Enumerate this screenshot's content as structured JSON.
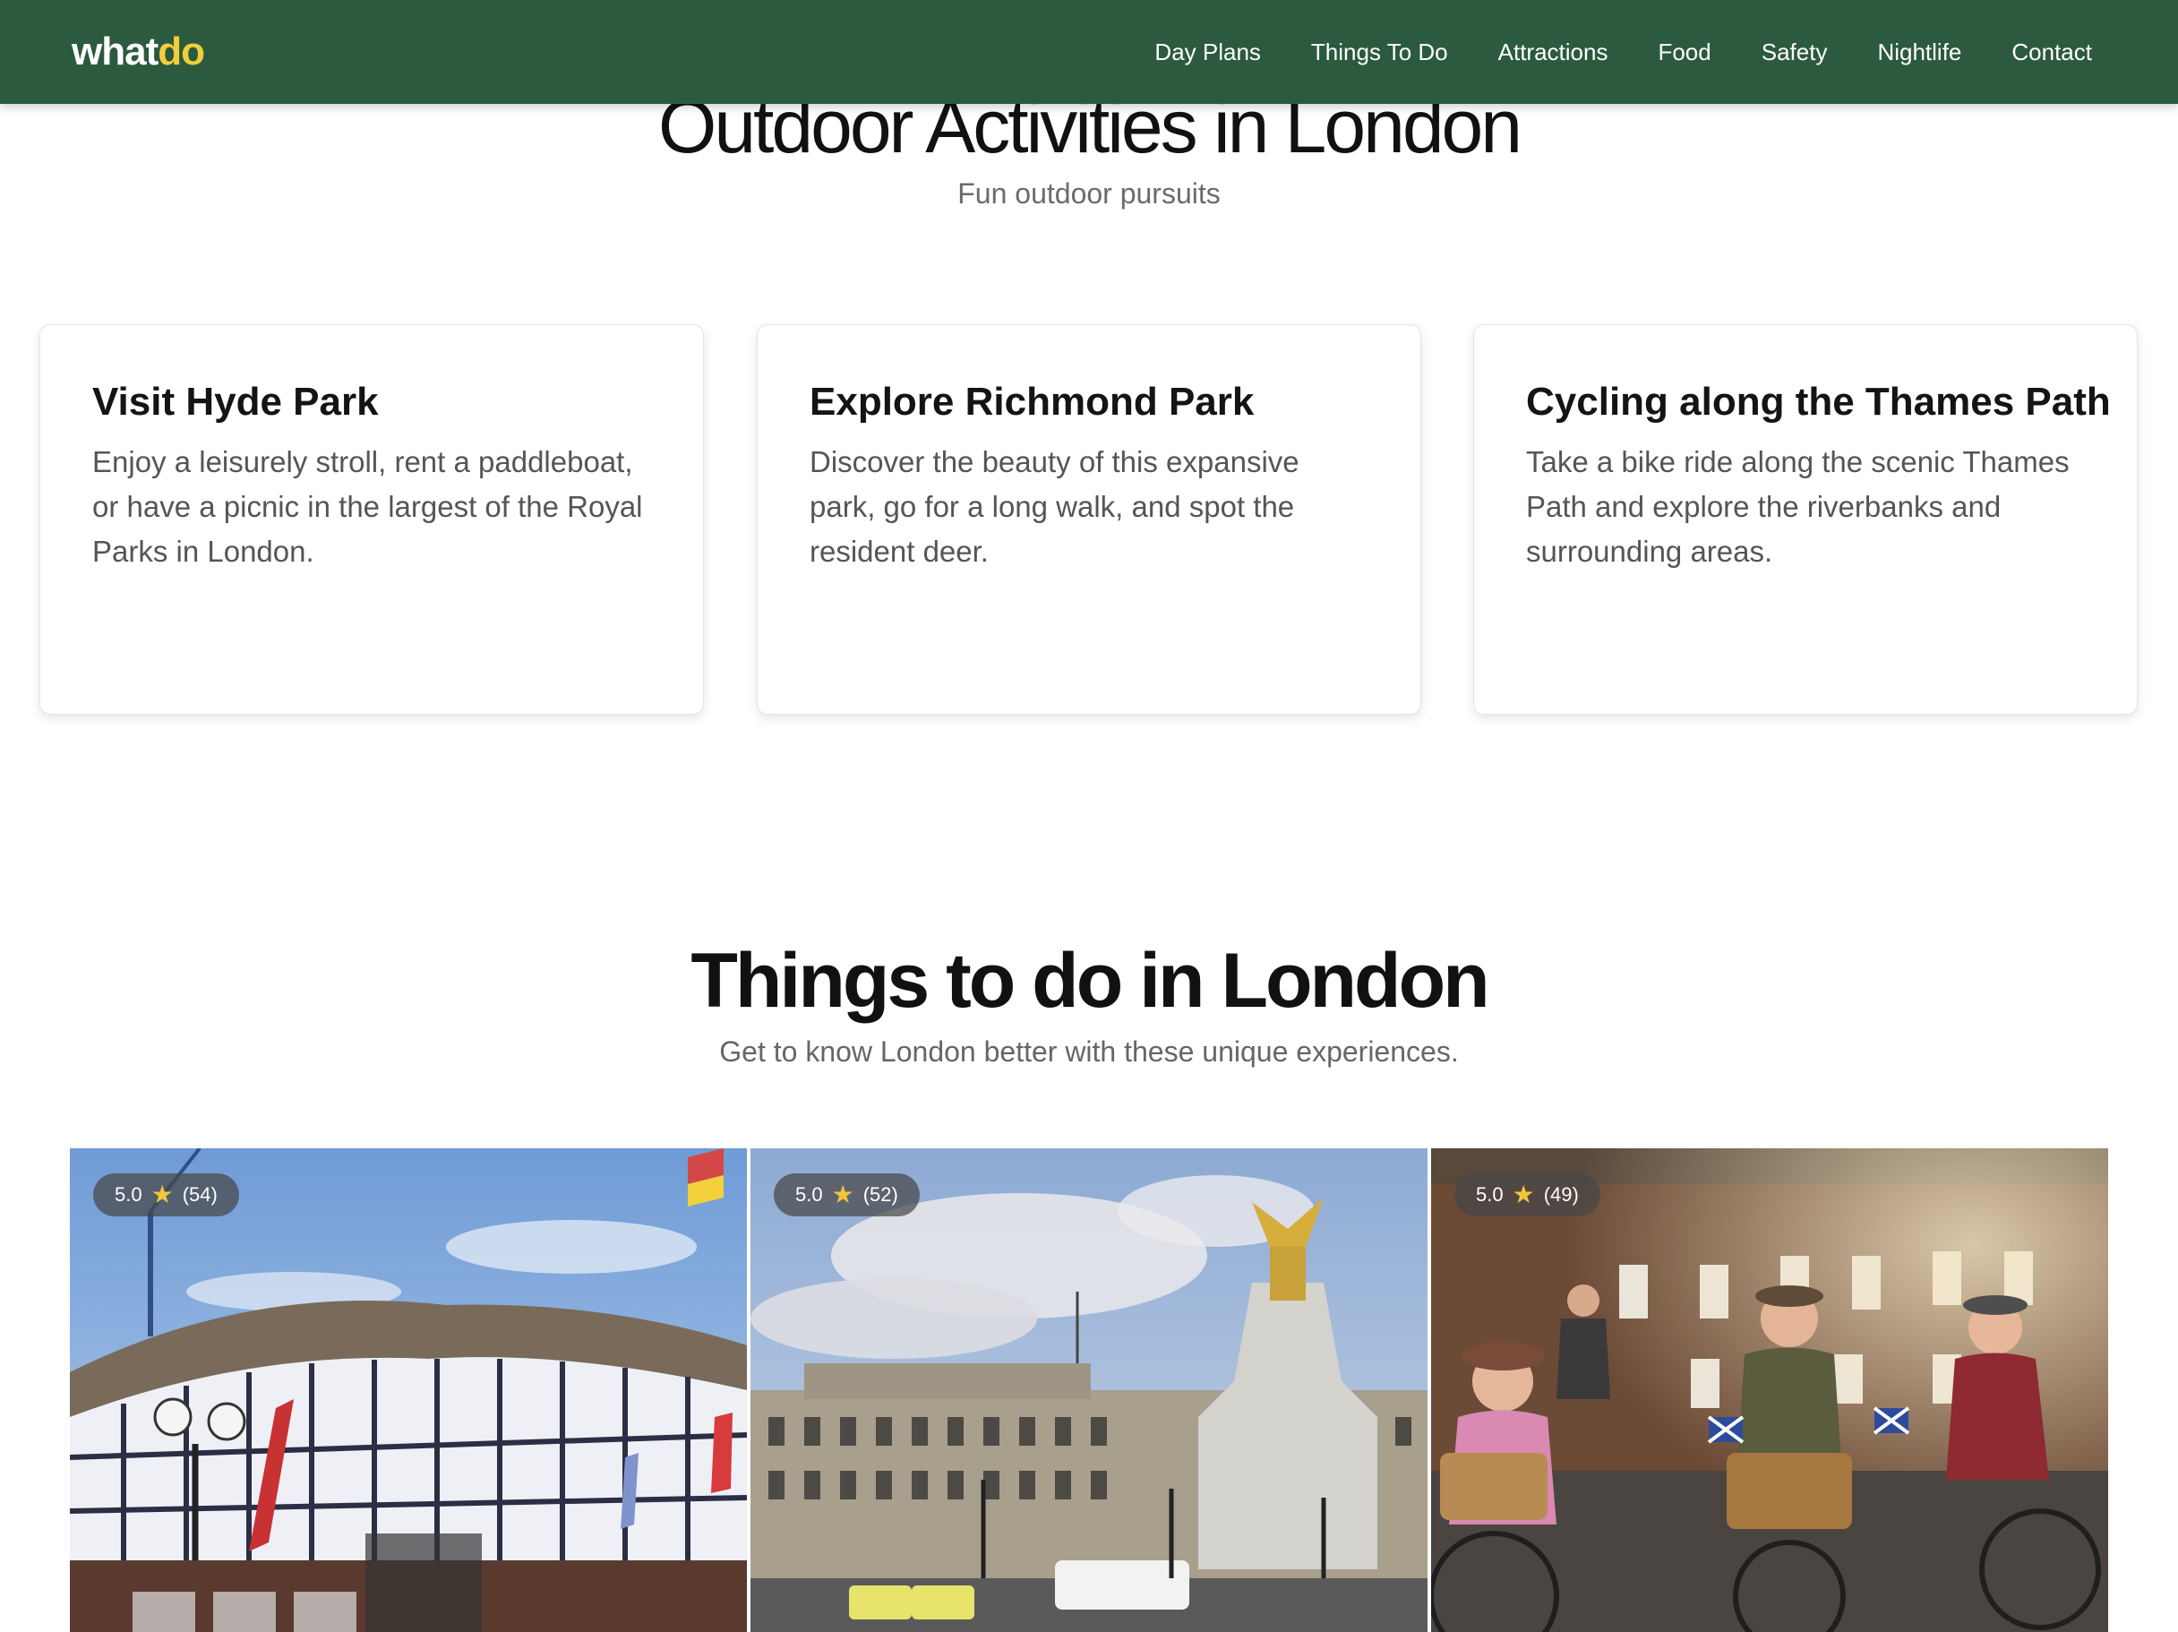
{
  "brand": {
    "part1": "what",
    "part2": "do"
  },
  "nav": {
    "items": [
      "Day Plans",
      "Things To Do",
      "Attractions",
      "Food",
      "Safety",
      "Nightlife",
      "Contact"
    ]
  },
  "outdoor": {
    "title": "Outdoor Activities in London",
    "subtitle": "Fun outdoor pursuits",
    "cards": [
      {
        "title": "Visit Hyde Park",
        "text": "Enjoy a leisurely stroll, rent a paddleboat, or have a picnic in the largest of the Royal Parks in London."
      },
      {
        "title": "Explore Richmond Park",
        "text": "Discover the beauty of this expansive park, go for a long walk, and spot the resident deer."
      },
      {
        "title": "Cycling along the Thames Path",
        "text": "Take a bike ride along the scenic Thames Path and explore the riverbanks and surrounding areas."
      }
    ]
  },
  "things": {
    "title": "Things to do in London",
    "subtitle": "Get to know London better with these unique experiences.",
    "items": [
      {
        "rating": "5.0",
        "count": "(54)",
        "image": "shakespeares-globe-photo"
      },
      {
        "rating": "5.0",
        "count": "(52)",
        "image": "buckingham-palace-photo"
      },
      {
        "rating": "5.0",
        "count": "(49)",
        "image": "tweed-cyclists-photo"
      }
    ]
  },
  "colors": {
    "nav_bg": "#2c5a3e",
    "logo_accent": "#f2cf3a",
    "star": "#f2c53d"
  }
}
